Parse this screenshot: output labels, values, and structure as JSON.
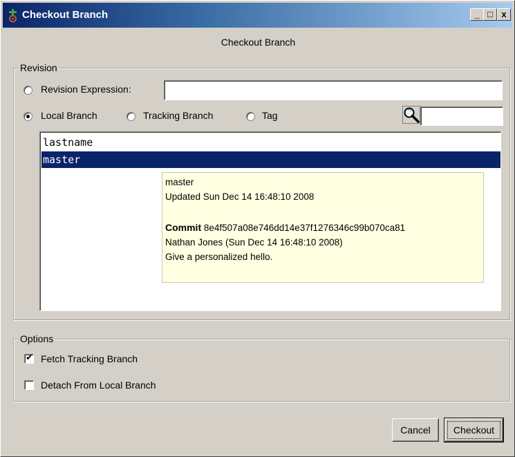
{
  "window": {
    "title": "Checkout Branch",
    "icon": "git-branch-icon",
    "controls": [
      "_",
      "□",
      "x"
    ]
  },
  "heading": "Checkout Branch",
  "revision": {
    "legend": "Revision",
    "revision_expression_label": "Revision Expression:",
    "revision_expression_value": "",
    "local_branch_label": "Local Branch",
    "tracking_branch_label": "Tracking Branch",
    "tag_label": "Tag",
    "selected_mode": "Local Branch",
    "filter_value": "",
    "filter_icon": "search-magnifier-icon",
    "branches": [
      {
        "name": "lastname",
        "selected": false
      },
      {
        "name": "master",
        "selected": true
      }
    ],
    "tooltip": {
      "branch": "master",
      "updated": "Updated Sun Dec 14 16:48:10 2008",
      "commit_label": "Commit",
      "commit_hash": "8e4f507a08e746dd14e37f1276346c99b070ca81",
      "author": "Nathan Jones (Sun Dec 14 16:48:10 2008)",
      "message": "Give a personalized hello."
    }
  },
  "options": {
    "legend": "Options",
    "fetch_tracking_label": "Fetch Tracking Branch",
    "fetch_tracking_checked": true,
    "detach_label": "Detach From Local Branch",
    "detach_checked": false
  },
  "buttons": {
    "cancel": "Cancel",
    "checkout": "Checkout"
  },
  "colors": {
    "titlebar_start": "#0a246a",
    "titlebar_end": "#a6caf0",
    "selection": "#0a246a",
    "tooltip_bg": "#ffffe1",
    "dialog_bg": "#d4d0c8"
  }
}
